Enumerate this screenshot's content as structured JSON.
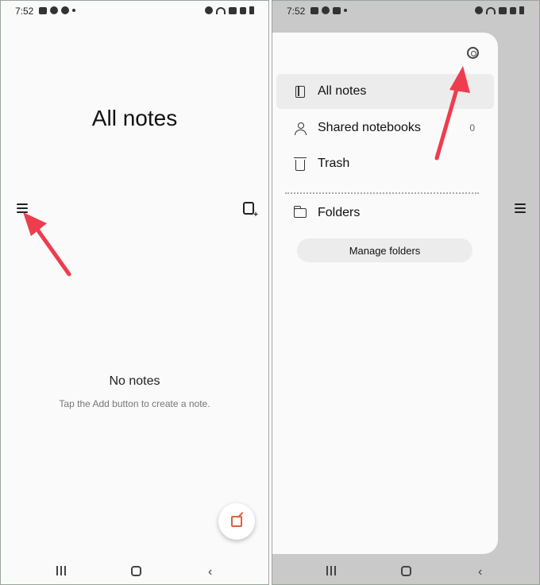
{
  "left": {
    "status": {
      "time": "7:52"
    },
    "title": "All notes",
    "empty_title": "No notes",
    "empty_subtitle": "Tap the Add button to create a note."
  },
  "right": {
    "status": {
      "time": "7:52"
    },
    "drawer": {
      "items": [
        {
          "label": "All notes",
          "active": true
        },
        {
          "label": "Shared notebooks",
          "count": "0"
        },
        {
          "label": "Trash"
        }
      ],
      "folders_label": "Folders",
      "manage_folders": "Manage folders"
    }
  },
  "colors": {
    "annotation_arrow": "#ee3d4f",
    "accent": "#e0603c"
  },
  "icons": [
    "menu-icon",
    "pdf-add-icon",
    "compose-icon",
    "settings-icon",
    "notebook-icon",
    "person-icon",
    "trash-icon",
    "folder-icon"
  ]
}
